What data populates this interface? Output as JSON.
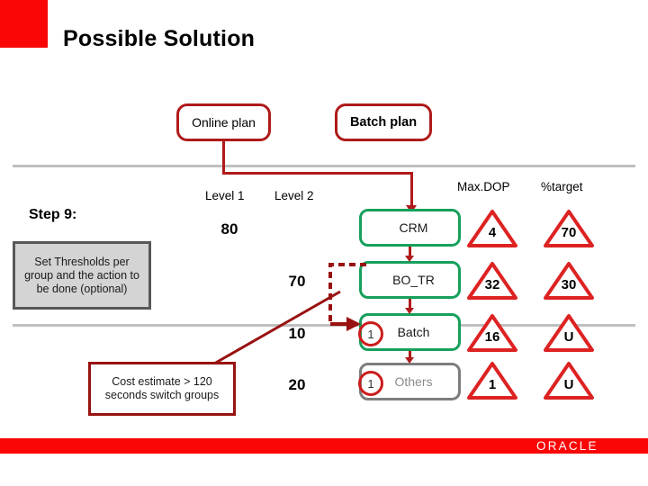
{
  "slide": {
    "title": "Possible Solution",
    "brand": {
      "wordmark": "ORACLE",
      "accent_color": "#fb0606",
      "green_color": "#16a05c",
      "dark_red_color": "#b01a1a",
      "grey_color": "#c0c0c0"
    }
  },
  "callouts": {
    "online_plan": "Online plan",
    "batch_plan": "Batch plan"
  },
  "step": {
    "label": "Step 9:",
    "threshold_note": "Set Thresholds per group and the action to be done (optional)",
    "cost_note": "Cost estimate > 120 seconds switch groups"
  },
  "columns": {
    "level1": "Level 1",
    "level2": "Level 2",
    "maxdop": "Max.DOP",
    "target": "%target"
  },
  "levels": {
    "level1_values": [
      "80"
    ],
    "level2_values": [
      "70",
      "10",
      "20"
    ]
  },
  "groups": [
    {
      "name": "CRM",
      "badge": "",
      "style": "green"
    },
    {
      "name": "BO_TR",
      "badge": "",
      "style": "green"
    },
    {
      "name": "Batch",
      "badge": "1",
      "style": "green"
    },
    {
      "name": "Others",
      "badge": "1",
      "style": "grey"
    }
  ],
  "indicators": {
    "maxdop": [
      "4",
      "32",
      "16",
      "1"
    ],
    "target": [
      "70",
      "30",
      "U",
      "U"
    ]
  }
}
